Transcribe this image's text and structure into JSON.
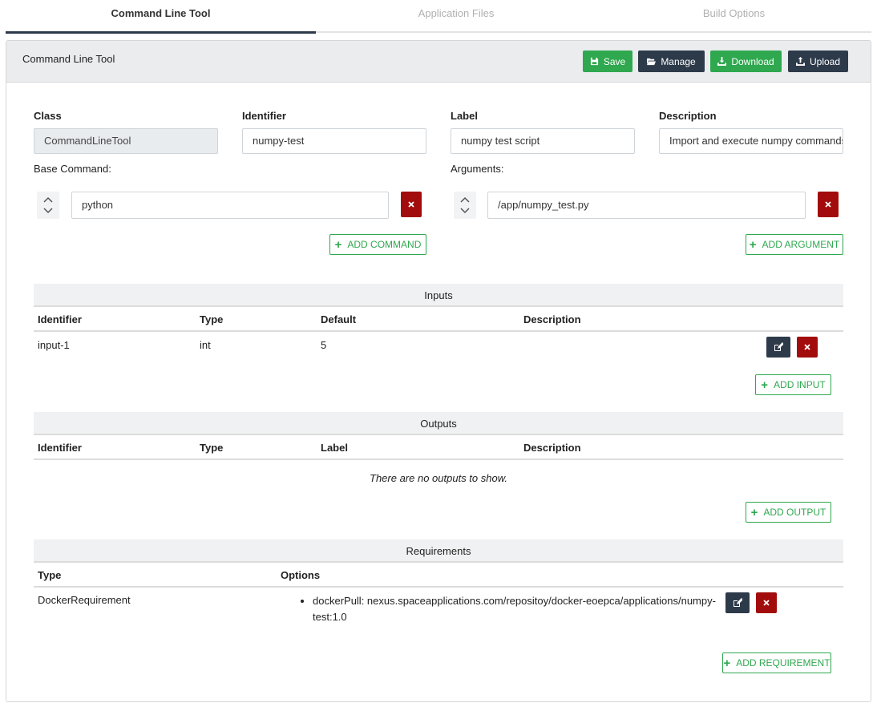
{
  "tabs": [
    {
      "label": "Command Line Tool",
      "active": true
    },
    {
      "label": "Application Files",
      "active": false
    },
    {
      "label": "Build Options",
      "active": false
    }
  ],
  "panel": {
    "title": "Command Line Tool",
    "buttons": {
      "save": "Save",
      "manage": "Manage",
      "download": "Download",
      "upload": "Upload"
    }
  },
  "fields": {
    "class_label": "Class",
    "class_value": "CommandLineTool",
    "identifier_label": "Identifier",
    "identifier_value": "numpy-test",
    "label_label": "Label",
    "label_value": "numpy test script",
    "description_label": "Description",
    "description_value": "Import and execute numpy commands",
    "base_command_label": "Base Command:",
    "base_command_value": "python",
    "arguments_label": "Arguments:",
    "argument_value": "/app/numpy_test.py",
    "add_command": "ADD COMMAND",
    "add_argument": "ADD ARGUMENT"
  },
  "inputs": {
    "title": "Inputs",
    "columns": [
      "Identifier",
      "Type",
      "Default",
      "Description"
    ],
    "rows": [
      {
        "identifier": "input-1",
        "type": "int",
        "default": "5",
        "description": ""
      }
    ],
    "add_label": "ADD INPUT"
  },
  "outputs": {
    "title": "Outputs",
    "columns": [
      "Identifier",
      "Type",
      "Label",
      "Description"
    ],
    "empty_text": "There are no outputs to show.",
    "add_label": "ADD OUTPUT"
  },
  "requirements": {
    "title": "Requirements",
    "columns": [
      "Type",
      "Options"
    ],
    "rows": [
      {
        "type": "DockerRequirement",
        "option": "dockerPull: nexus.spaceapplications.com/repositoy/docker-eoepca/applications/numpy-test:1.0"
      }
    ],
    "add_label": "ADD REQUIREMENT"
  },
  "colors": {
    "green": "#2fa84f",
    "navy": "#2d3a4a",
    "danger": "#a30c0c"
  },
  "icons": [
    "save-icon",
    "folder-open-icon",
    "download-icon",
    "upload-icon",
    "sort-arrows-icon",
    "close-icon",
    "edit-icon",
    "plus-icon"
  ]
}
